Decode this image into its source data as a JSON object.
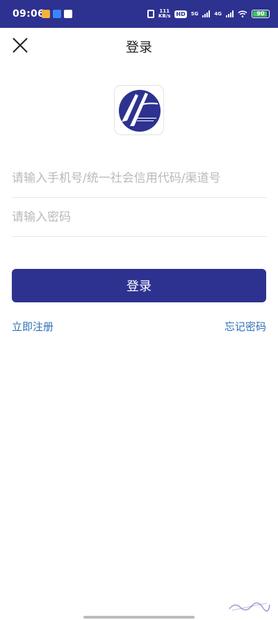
{
  "status_bar": {
    "time": "09:06",
    "net_speed_value": "111",
    "net_speed_unit": "KB/s",
    "hd_label": "HD",
    "network_5g": "5G",
    "network_4g": "4G",
    "battery_level": "90",
    "battery_fraction": 0.9,
    "bg_color": "#2d3290",
    "battery_color": "#3ec45a"
  },
  "header": {
    "title": "登录",
    "close_icon": "close-icon"
  },
  "logo": {
    "icon": "zunyi-airport-logo",
    "brand_color": "#2d3290"
  },
  "form": {
    "phone_placeholder": "请输入手机号/统一社会信用代码/渠道号",
    "phone_value": "",
    "password_placeholder": "请输入密码",
    "password_value": ""
  },
  "actions": {
    "login_label": "登录",
    "register_label": "立即注册",
    "forgot_label": "忘记密码",
    "accent_color": "#2d3290",
    "link_color": "#2f6fb6"
  }
}
